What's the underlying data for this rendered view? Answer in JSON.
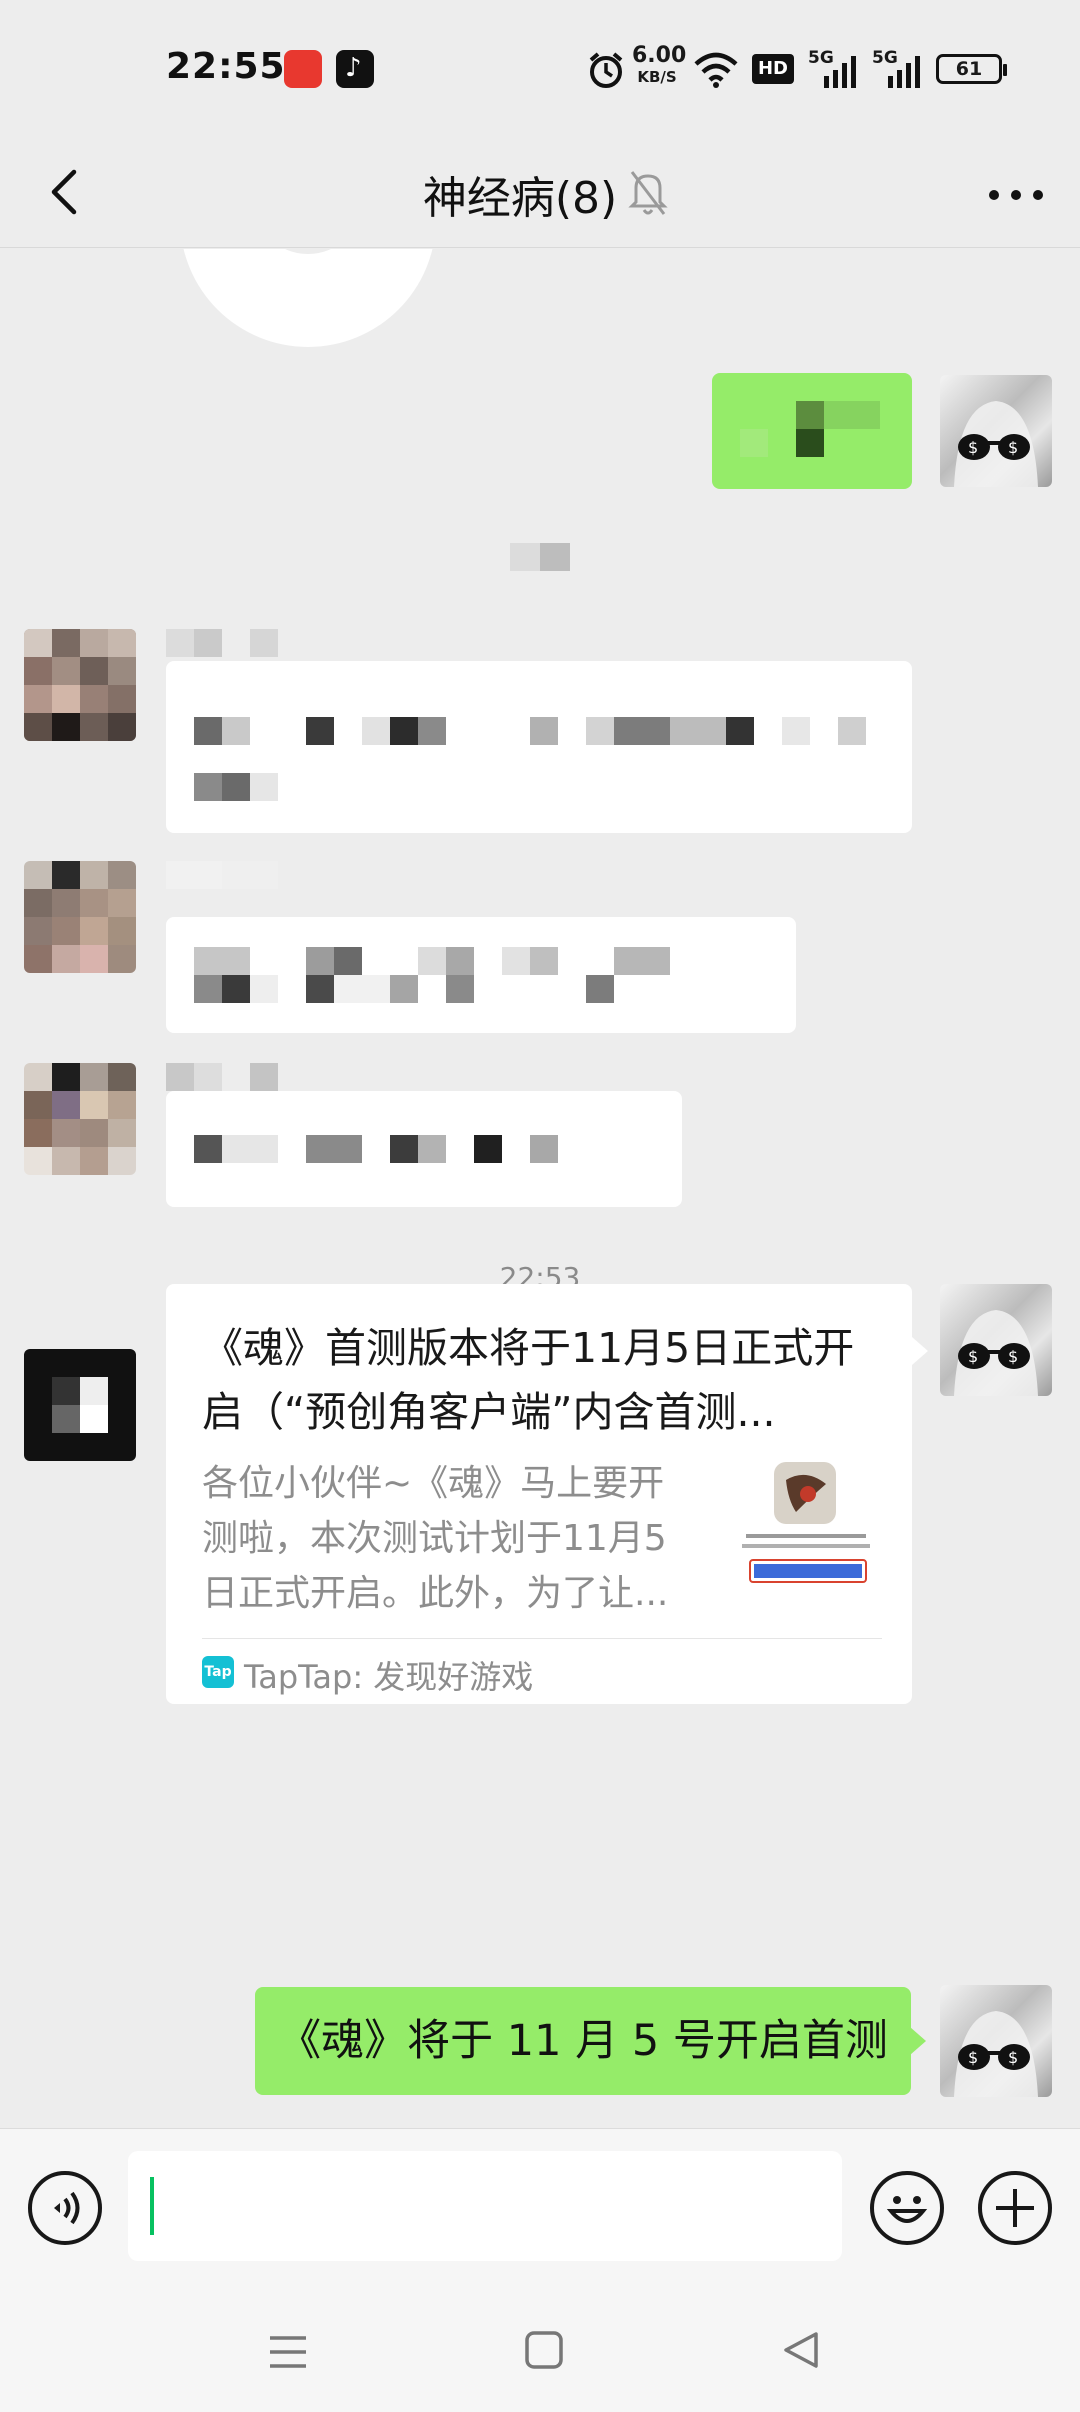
{
  "status_bar": {
    "time": "22:55",
    "net_speed_value": "6.00",
    "net_speed_unit": "KB/S",
    "hd_label": "HD",
    "signal1": "5G",
    "signal2": "5G",
    "battery": "61"
  },
  "header": {
    "title": "神经病(8)"
  },
  "chat": {
    "timestamp": "22:53",
    "link_card": {
      "title": "《魂》首测版本将于11月5日正式开启（“预创角客户端”内含首测...",
      "description": "各位小伙伴~《魂》马上要开测啦，本次测试计划于11月5日正式开启。此外，为了让...",
      "source_icon": "Tap",
      "source": "TapTap: 发现好游戏"
    },
    "self_message": "《魂》将于 11 月 5 号开启首测"
  },
  "input": {
    "value": ""
  },
  "colors": {
    "bubble_self": "#95ec69",
    "bubble_other": "#ffffff",
    "background": "#ededed",
    "caret": "#07c160"
  }
}
